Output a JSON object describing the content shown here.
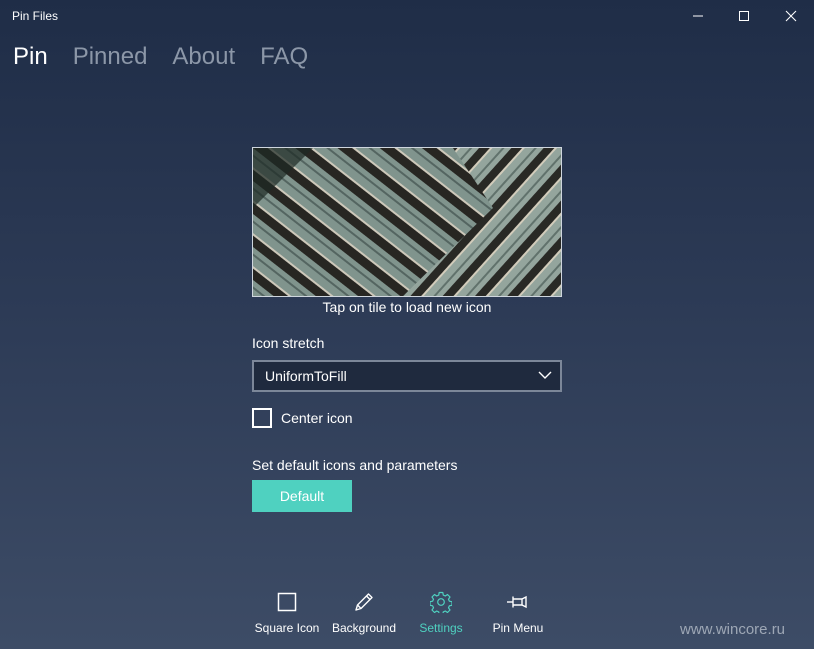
{
  "window": {
    "title": "Pin Files"
  },
  "tabs": [
    {
      "label": "Pin",
      "active": true
    },
    {
      "label": "Pinned",
      "active": false
    },
    {
      "label": "About",
      "active": false
    },
    {
      "label": "FAQ",
      "active": false
    }
  ],
  "tile": {
    "caption": "Tap on tile to load new icon"
  },
  "icon_stretch": {
    "label": "Icon stretch",
    "selected": "UniformToFill"
  },
  "center_icon": {
    "label": "Center icon",
    "checked": false
  },
  "defaults": {
    "text": "Set default icons and parameters",
    "button_label": "Default"
  },
  "appbar": {
    "items": [
      {
        "label": "Square Icon",
        "icon": "square-icon"
      },
      {
        "label": "Background",
        "icon": "pencil-icon"
      },
      {
        "label": "Settings",
        "icon": "gear-icon",
        "active": true
      },
      {
        "label": "Pin Menu",
        "icon": "pin-icon"
      }
    ]
  },
  "watermark": "www.wincore.ru",
  "colors": {
    "accent": "#4fd1c0",
    "tab_inactive": "#8c97a8",
    "background_top": "#1f2d47",
    "background_bottom": "#3d4c66"
  }
}
